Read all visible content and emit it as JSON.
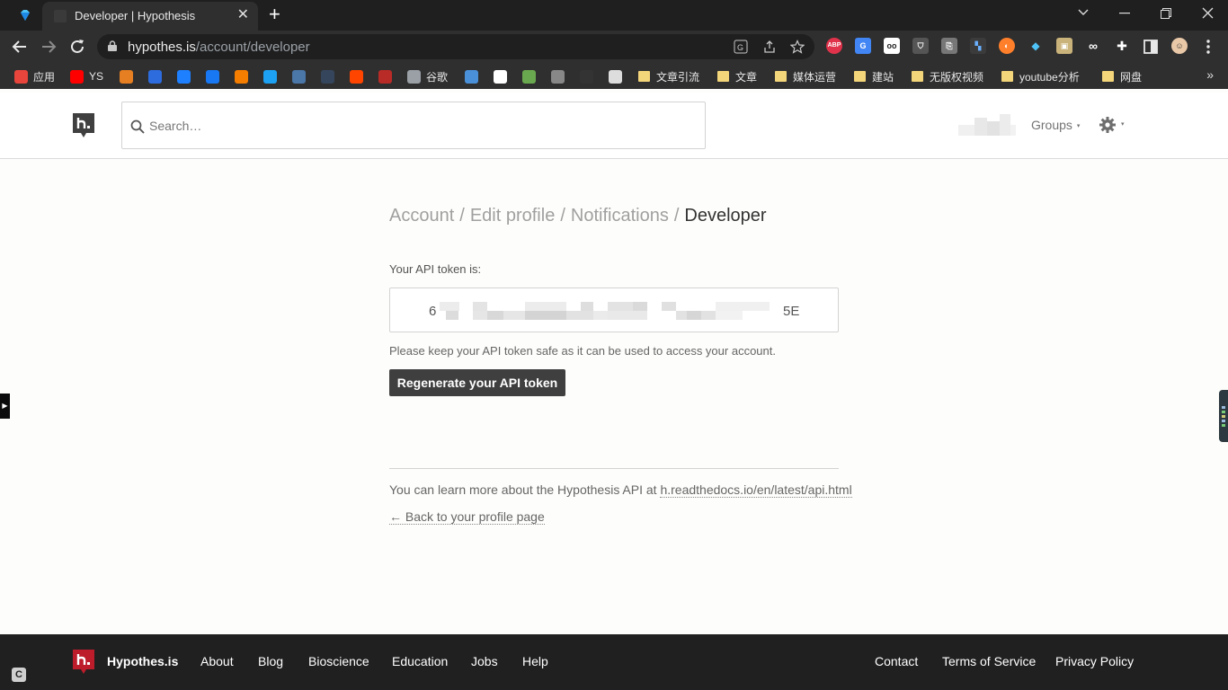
{
  "browser": {
    "tab_title": "Developer | Hypothesis",
    "tab_close": "✕",
    "new_tab": "+",
    "url_host": "hypothes.is",
    "url_path": "/account/developer",
    "bookmarks": [
      {
        "label": "应用",
        "color": "#e8453c",
        "icon": "apps-grid-icon"
      },
      {
        "label": "YS",
        "color": "#ff0000",
        "icon": "youtube-icon"
      },
      {
        "label": "",
        "color": "#e67e22",
        "icon": "bookmark-icon"
      },
      {
        "label": "",
        "color": "#2d6cdf",
        "icon": "baidu-icon"
      },
      {
        "label": "",
        "color": "#1e80ff",
        "icon": "zhihu-icon"
      },
      {
        "label": "",
        "color": "#1877f2",
        "icon": "facebook-icon"
      },
      {
        "label": "",
        "color": "#f57d00",
        "icon": "blogger-icon"
      },
      {
        "label": "",
        "color": "#1da1f2",
        "icon": "twitter-icon"
      },
      {
        "label": "",
        "color": "#4a76a8",
        "icon": "vk-icon"
      },
      {
        "label": "",
        "color": "#35465c",
        "icon": "tumblr-icon"
      },
      {
        "label": "",
        "color": "#ff4500",
        "icon": "reddit-icon"
      },
      {
        "label": "",
        "color": "#b92b27",
        "icon": "quora-icon"
      },
      {
        "label": "谷歌",
        "color": "#9aa0a6",
        "icon": "globe-icon"
      },
      {
        "label": "",
        "color": "#4a90d9",
        "icon": "bookmark-icon"
      },
      {
        "label": "",
        "color": "#ffffff",
        "icon": "wikipedia-icon"
      },
      {
        "label": "",
        "color": "#6aa84f",
        "icon": "bookmark-icon"
      },
      {
        "label": "",
        "color": "#888888",
        "icon": "bookmark-icon"
      },
      {
        "label": "",
        "color": "#333333",
        "icon": "bookmark-icon"
      },
      {
        "label": "",
        "color": "#dddddd",
        "icon": "bookmark-icon"
      }
    ],
    "folders": [
      "文章引流",
      "文章",
      "媒体运营",
      "建站",
      "无版权视频",
      "youtube分析",
      "网盘"
    ],
    "more": "»"
  },
  "header": {
    "search_placeholder": "Search…",
    "groups_label": "Groups",
    "groups_caret": "▾",
    "settings_caret": "▾"
  },
  "main": {
    "breadcrumb": {
      "account": "Account",
      "edit_profile": "Edit profile",
      "notifications": "Notifications",
      "current": "Developer",
      "separator": "/"
    },
    "token_label": "Your API token is:",
    "token_start": "6",
    "token_end": "5E",
    "token_note": "Please keep your API token safe as it can be used to access your account.",
    "regenerate_button": "Regenerate your API token",
    "learn_more_text": "You can learn more about the Hypothesis API at",
    "learn_more_link": "h.readthedocs.io/en/latest/api.html",
    "back_link": "← Back to your profile page"
  },
  "footer": {
    "brand": "Hypothes.is",
    "left_links": [
      "About",
      "Blog",
      "Bioscience",
      "Education",
      "Jobs",
      "Help"
    ],
    "right_links": [
      "Contact",
      "Terms of Service",
      "Privacy Policy"
    ]
  },
  "colors": {
    "brand_red": "#bd1c2b",
    "button_dark": "#3f3f3f",
    "footer_bg": "#202020"
  }
}
